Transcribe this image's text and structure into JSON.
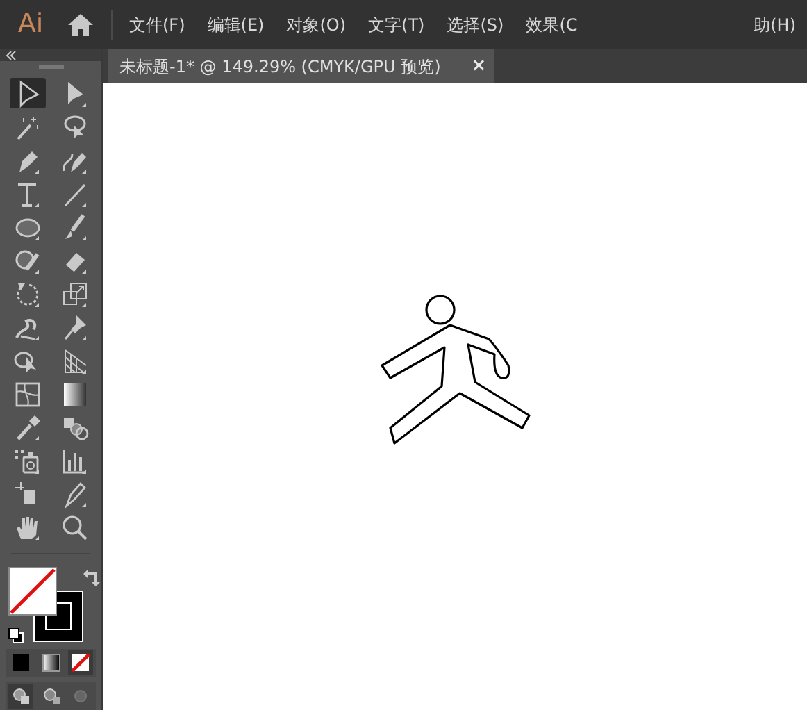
{
  "app": {
    "logo": "Ai"
  },
  "menu": [
    {
      "label": "文件(F)"
    },
    {
      "label": "编辑(E)"
    },
    {
      "label": "对象(O)"
    },
    {
      "label": "文字(T)"
    },
    {
      "label": "选择(S)"
    },
    {
      "label": "效果(C"
    },
    {
      "label": "助(H)"
    }
  ],
  "document_tab": {
    "title": "未标题-1* @ 149.29% (CMYK/GPU 预览)",
    "close": "×"
  },
  "tools": [
    {
      "selected": true
    },
    {
      "selected": false
    },
    {
      "selected": false
    },
    {
      "selected": false
    },
    {
      "selected": false
    },
    {
      "selected": false
    },
    {
      "selected": false
    },
    {
      "selected": false
    },
    {
      "selected": false
    },
    {
      "selected": false
    },
    {
      "selected": false
    },
    {
      "selected": false
    },
    {
      "selected": false
    },
    {
      "selected": false
    },
    {
      "selected": false
    },
    {
      "selected": false
    },
    {
      "selected": false
    },
    {
      "selected": false
    },
    {
      "selected": false
    },
    {
      "selected": false
    },
    {
      "selected": false
    },
    {
      "selected": false
    },
    {
      "selected": false
    },
    {
      "selected": false
    },
    {
      "selected": false
    },
    {
      "selected": false
    },
    {
      "selected": false
    },
    {
      "selected": false
    }
  ],
  "color_modes": [
    {
      "selected": false
    },
    {
      "selected": false
    },
    {
      "selected": true
    }
  ],
  "draw_modes": [
    {
      "selected": true
    },
    {
      "selected": false
    },
    {
      "selected": false
    }
  ]
}
